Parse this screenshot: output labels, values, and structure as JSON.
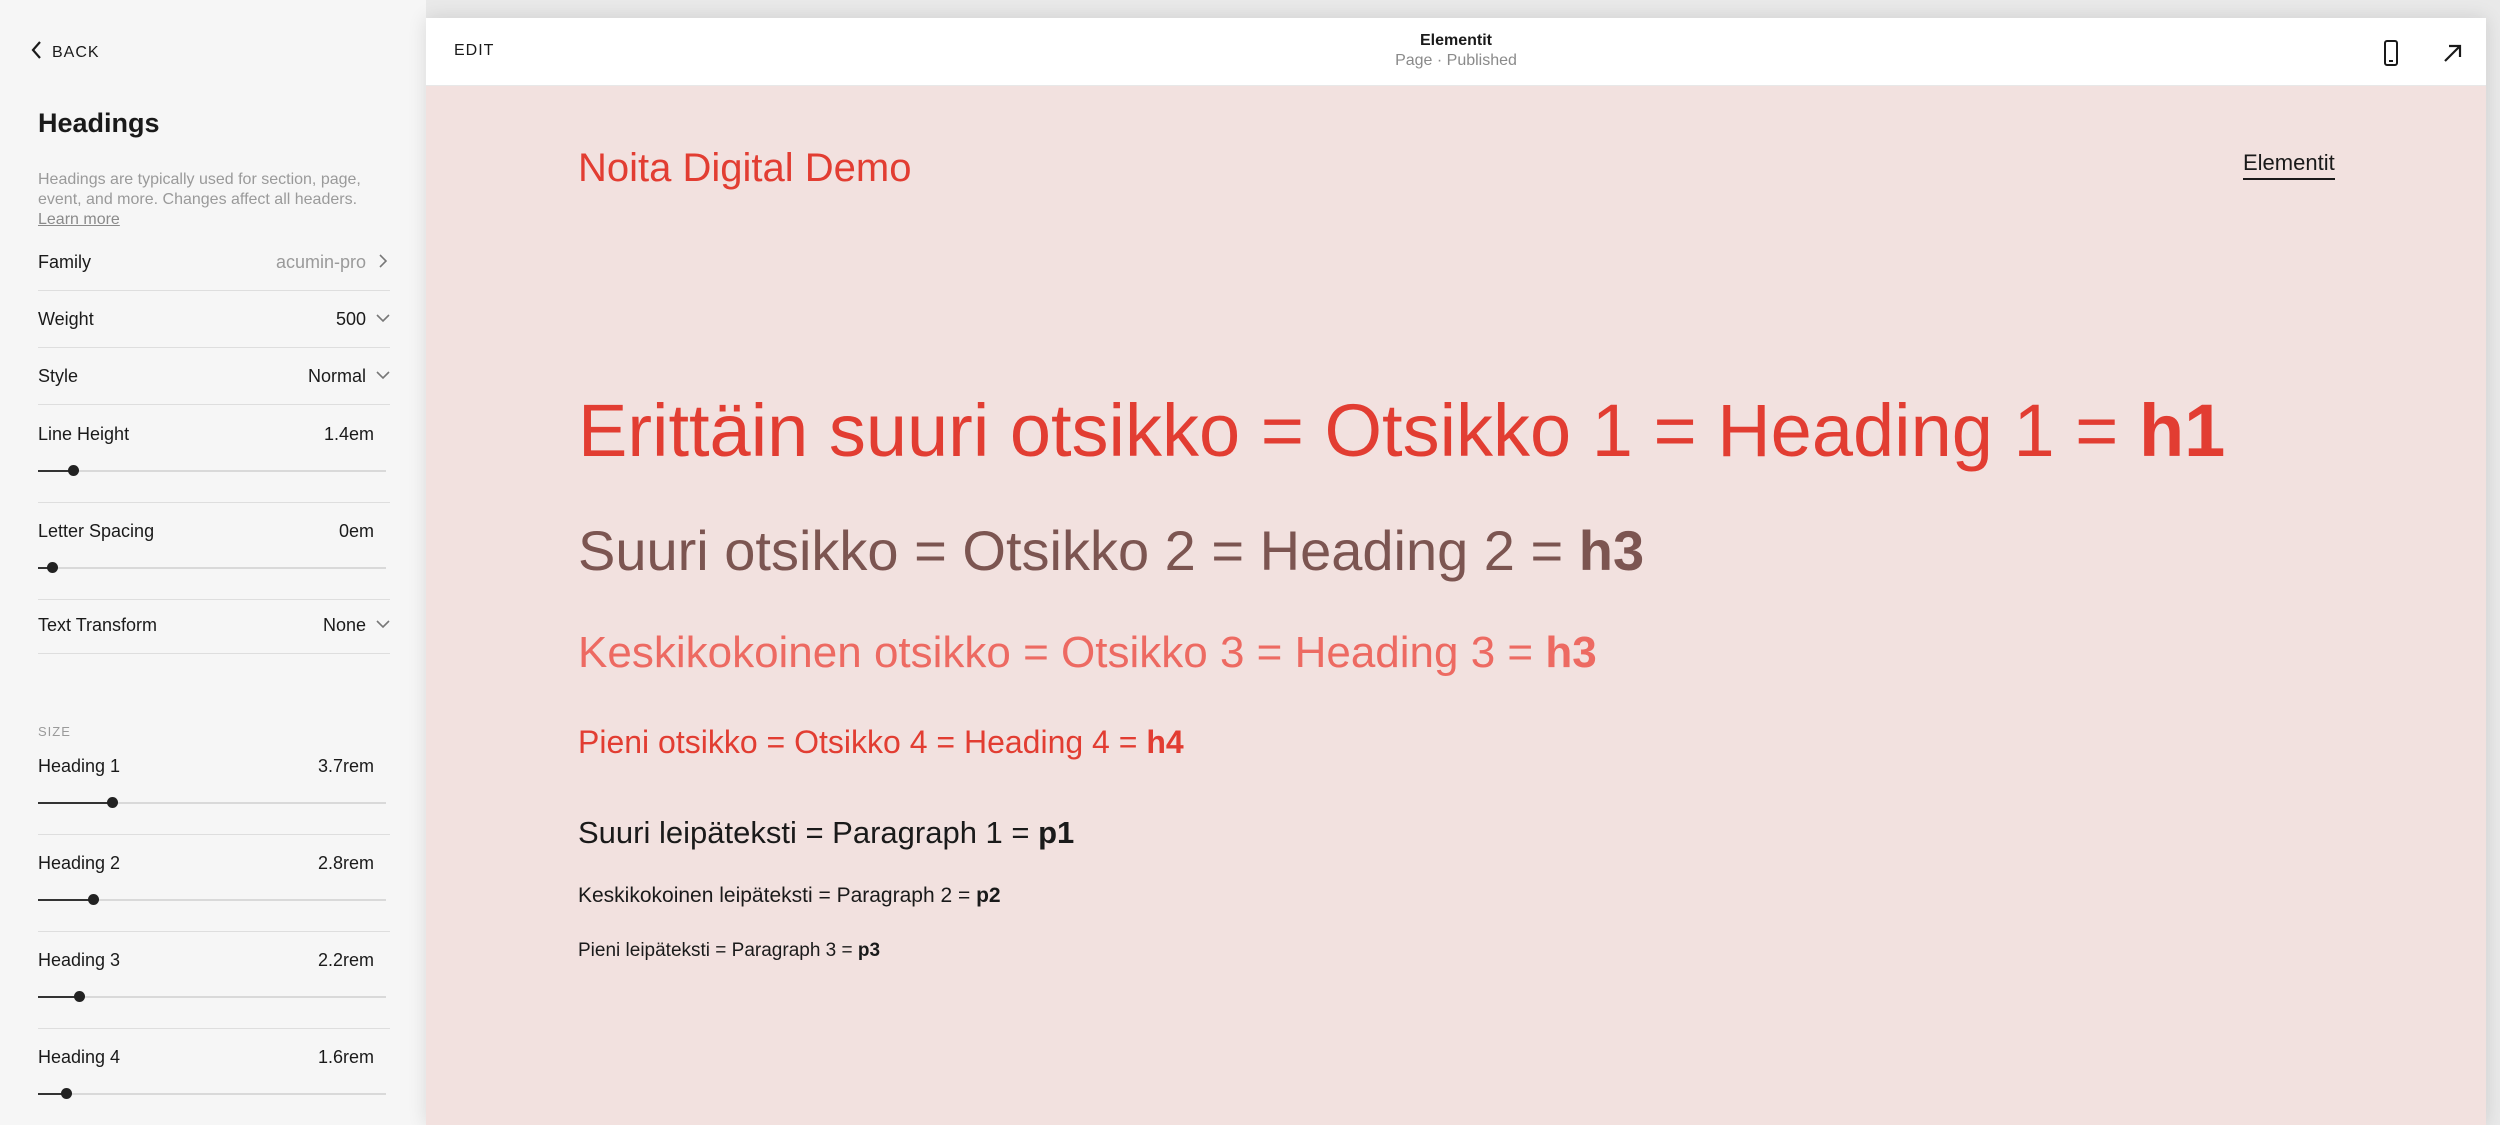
{
  "panel": {
    "back_label": "BACK",
    "title": "Headings",
    "description": "Headings are typically used for section, page, event, and more. Changes affect all headers.",
    "learn_more": "Learn more",
    "family": {
      "label": "Family",
      "value": "acumin-pro"
    },
    "weight": {
      "label": "Weight",
      "value": "500"
    },
    "style": {
      "label": "Style",
      "value": "Normal"
    },
    "line_height": {
      "label": "Line Height",
      "value": "1.4em",
      "level": 0.1
    },
    "letter_spacing": {
      "label": "Letter Spacing",
      "value": "0em",
      "level": 0.04
    },
    "text_transform": {
      "label": "Text Transform",
      "value": "None"
    },
    "size_section": "SIZE",
    "sizes": [
      {
        "label": "Heading 1",
        "value": "3.7rem",
        "level": 0.212
      },
      {
        "label": "Heading 2",
        "value": "2.8rem",
        "level": 0.158
      },
      {
        "label": "Heading 3",
        "value": "2.2rem",
        "level": 0.118
      },
      {
        "label": "Heading 4",
        "value": "1.6rem",
        "level": 0.08
      }
    ]
  },
  "topbar": {
    "edit_label": "EDIT",
    "page_name": "Elementit",
    "page_status": "Page · Published",
    "mobile_icon": "mobile-phone-icon",
    "open_icon": "arrow-up-right-icon"
  },
  "site": {
    "title": "Noita Digital Demo",
    "nav_link": "Elementit",
    "colors": {
      "accent": "#e23d32",
      "background": "#f2e1df",
      "h2": "#7c5551",
      "h3": "#ed6a62"
    },
    "h1": {
      "text": "Erittäin suuri otsikko = Otsikko 1 = Heading 1 = ",
      "tag": "h1"
    },
    "h2": {
      "text": "Suuri otsikko = Otsikko 2 = Heading 2 = ",
      "tag": "h3"
    },
    "h3": {
      "text": "Keskikokoinen otsikko = Otsikko 3 = Heading 3 = ",
      "tag": "h3"
    },
    "h4": {
      "text": "Pieni otsikko = Otsikko 4 = Heading 4 = ",
      "tag": "h4"
    },
    "p1": {
      "text": "Suuri leipäteksti = Paragraph 1 = ",
      "tag": "p1"
    },
    "p2": {
      "text": "Keskikokoinen leipäteksti = Paragraph 2 = ",
      "tag": "p2"
    },
    "p3": {
      "text": "Pieni leipäteksti = Paragraph 3 = ",
      "tag": "p3"
    }
  }
}
